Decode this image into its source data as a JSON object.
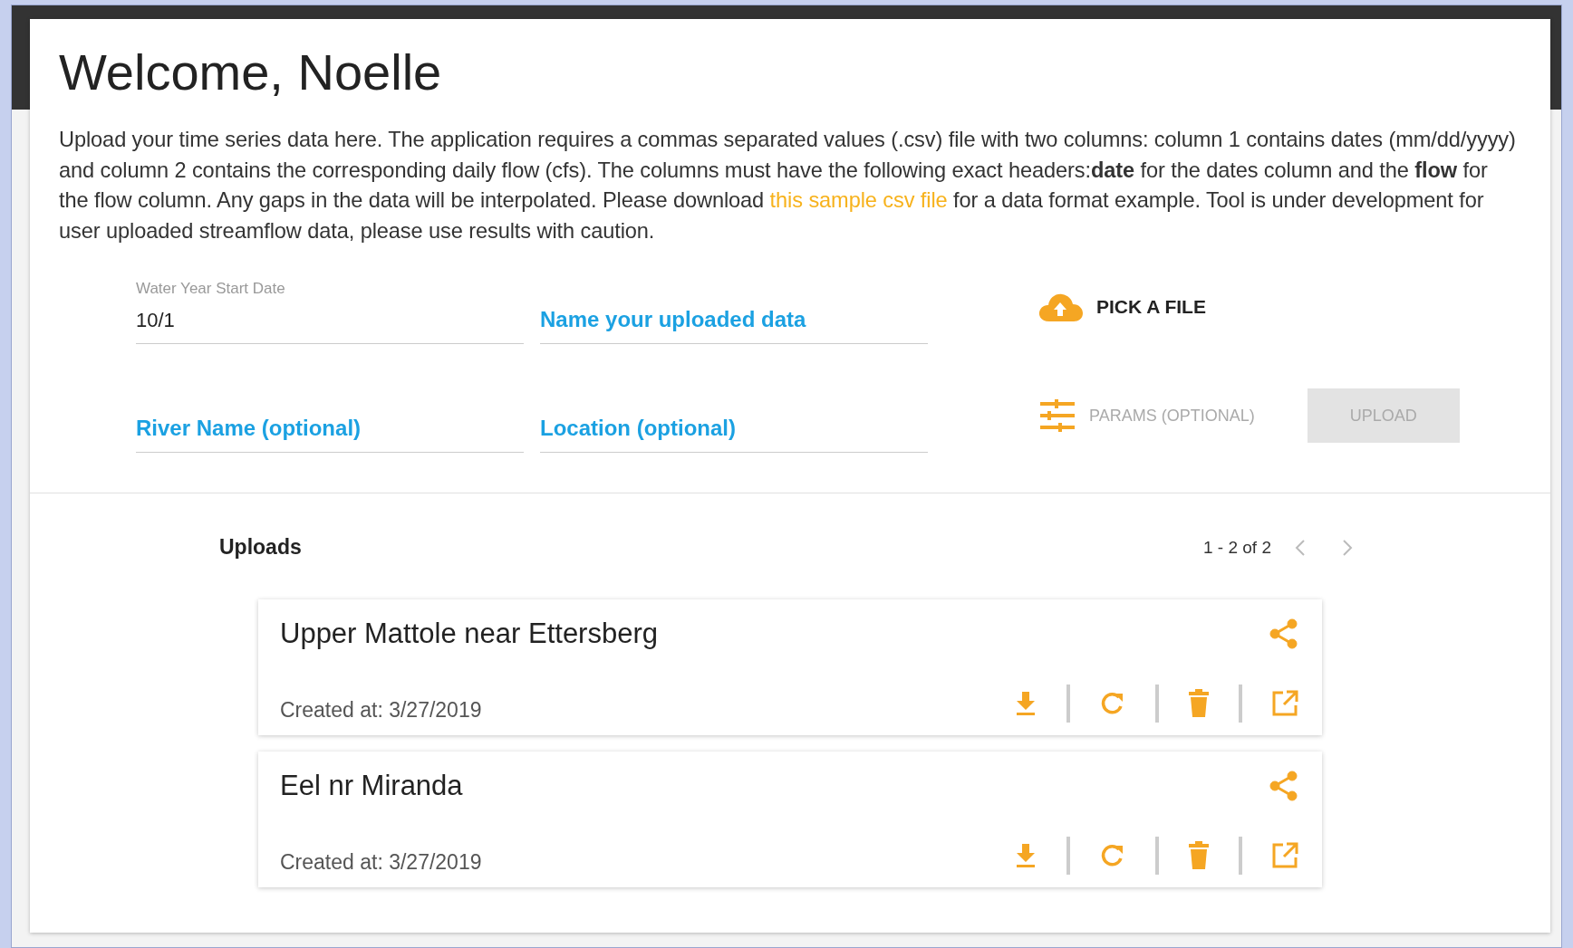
{
  "title": "Welcome, Noelle",
  "intro": {
    "before": "Upload your time series data here. The application requires a commas separated values (.csv) file with two columns: column 1 contains dates (mm/dd/yyyy) and column 2 contains the corresponding daily flow (cfs). The columns must have the following exact headers:**date** for the dates column and the **flow** for the flow column. Any gaps in the data will be interpolated. Please download ",
    "link": "this sample csv file",
    "after": " for a data format example. Tool is under development for user uploaded streamflow data, please use results with caution."
  },
  "fields": [
    {
      "label": "Water Year Start Date",
      "value": "10/1"
    },
    {
      "placeholder": "Name your uploaded data"
    },
    {
      "placeholder": "River Name (optional)"
    },
    {
      "placeholder": "Location (optional)"
    }
  ],
  "pick_file": {
    "label": "PICK A FILE"
  },
  "params_button": {
    "label": "PARAMS (OPTIONAL)",
    "disabled": true
  },
  "upload_button": {
    "label": "UPLOAD",
    "disabled": true
  },
  "uploads": {
    "title": "Uploads",
    "range": "1 - 2 of 2",
    "items": [
      {
        "name": "Upper Mattole near Ettersberg",
        "created": "Created at: 3/27/2019"
      },
      {
        "name": "Eel nr Miranda",
        "created": "Created at: 3/27/2019"
      }
    ]
  }
}
